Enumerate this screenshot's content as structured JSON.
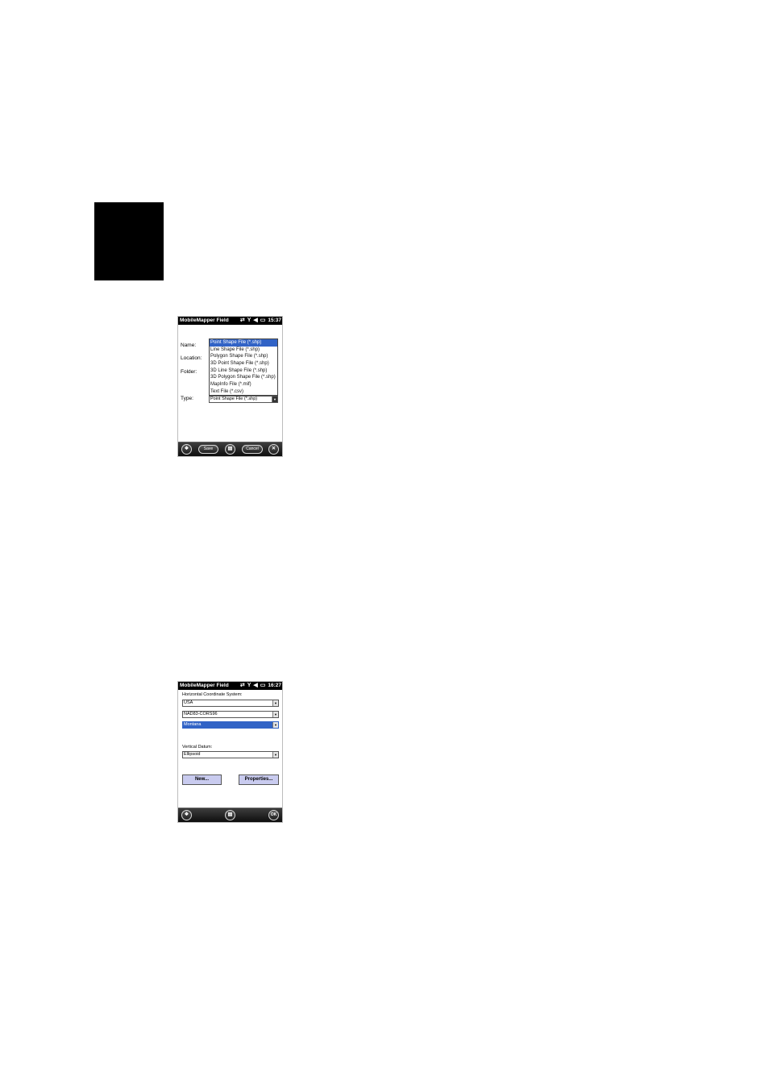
{
  "screen1": {
    "app_title": "MobileMapper Field",
    "clock": "15:37",
    "labels": {
      "name": "Name:",
      "location": "Location:",
      "folder": "Folder:",
      "type": "Type:"
    },
    "type_options": [
      "Point Shape File (*.shp)",
      "Line Shape File (*.shp)",
      "Polygon Shape File (*.shp)",
      "3D Point Shape File (*.shp)",
      "3D Line Shape File (*.shp)",
      "3D Polygon Shape File (*.shp)",
      "MapInfo File (*.mif)",
      "Text File (*.csv)"
    ],
    "type_selected": "Point Shape File (*.shp)",
    "taskbar": {
      "save": "Save",
      "cancel": "Cancel"
    }
  },
  "screen2": {
    "app_title": "MobileMapper Field",
    "clock": "16:27",
    "horizontal_label": "Horizontal Coordinate System:",
    "country": "USA",
    "datum": "NAD83-CORS96",
    "zone": "Montana",
    "vertical_label": "Vertical Datum:",
    "vertical": "Ellipsoid",
    "new_button": "New...",
    "properties_button": "Properties...",
    "taskbar": {
      "ok": "OK"
    }
  }
}
